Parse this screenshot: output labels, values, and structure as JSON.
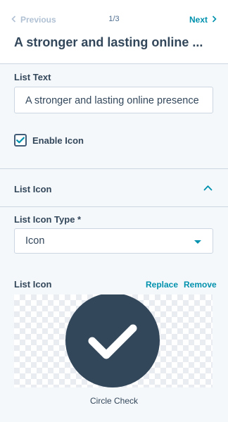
{
  "header": {
    "previous_label": "Previous",
    "pager": "1/3",
    "next_label": "Next",
    "title": "A stronger and lasting online ..."
  },
  "list_text": {
    "label": "List Text",
    "value": "A stronger and lasting online presence"
  },
  "enable_icon": {
    "label": "Enable Icon",
    "checked": true
  },
  "list_icon_section": {
    "title": "List Icon",
    "expanded": true
  },
  "list_icon_type": {
    "label": "List Icon Type *",
    "value": "Icon"
  },
  "list_icon": {
    "label": "List Icon",
    "replace_label": "Replace",
    "remove_label": "Remove",
    "icon_name": "circle-check-icon",
    "caption": "Circle Check",
    "icon_color": "#33475b"
  },
  "colors": {
    "accent": "#0091ae",
    "text": "#33475b",
    "border": "#cbd6e2",
    "background": "#f5f8fa"
  }
}
